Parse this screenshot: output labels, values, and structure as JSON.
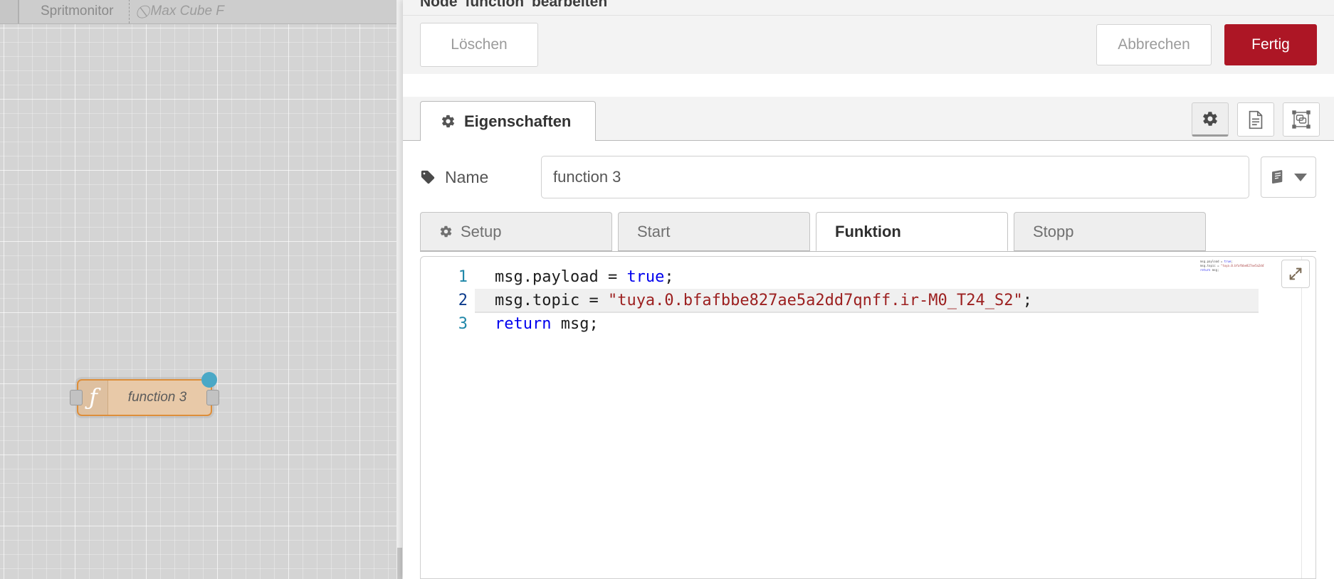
{
  "canvas": {
    "tabs": [
      {
        "label": "Spritmonitor",
        "icon": "",
        "disabled": false
      },
      {
        "label": "Max Cube F",
        "icon": "no-entry-icon",
        "disabled": true
      }
    ],
    "node": {
      "label": "function 3",
      "icon": "function-f-icon",
      "border_color": "#dd8e3a",
      "fill_color": "#e8c9a8",
      "status_dot_color": "#4aa8c6"
    }
  },
  "dialog": {
    "title": "Node 'function' bearbeiten",
    "buttons": {
      "delete": "Löschen",
      "cancel": "Abbrechen",
      "done": "Fertig",
      "done_color": "#ad1625"
    },
    "tabs": [
      {
        "label": "Eigenschaften",
        "icon": "gear-icon",
        "active": true
      }
    ],
    "icon_buttons": [
      {
        "name": "gear-icon",
        "active": true
      },
      {
        "name": "description-icon",
        "active": false
      },
      {
        "name": "appearance-icon",
        "active": false
      }
    ],
    "name_row": {
      "label": "Name",
      "icon": "tag-icon",
      "value": "function 3",
      "placeholder": "Name",
      "library_button_icon": "book-icon"
    },
    "function_tabs": [
      {
        "label": "Setup",
        "icon": "gear-icon",
        "active": false
      },
      {
        "label": "Start",
        "icon": "",
        "active": false
      },
      {
        "label": "Funktion",
        "icon": "",
        "active": true
      },
      {
        "label": "Stopp",
        "icon": "",
        "active": false
      }
    ],
    "editor": {
      "expand_icon": "expand-arrows-icon",
      "lines": [
        {
          "number": "1",
          "active": false,
          "segments": [
            {
              "text": "msg.payload = ",
              "type": "plain"
            },
            {
              "text": "true",
              "type": "keyword"
            },
            {
              "text": ";",
              "type": "plain"
            }
          ]
        },
        {
          "number": "2",
          "active": true,
          "segments": [
            {
              "text": "msg.topic = ",
              "type": "plain"
            },
            {
              "text": "\"tuya.0.bfafbbe827ae5a2dd7qnff.ir-M0_T24_S2\"",
              "type": "string"
            },
            {
              "text": ";",
              "type": "plain"
            }
          ]
        },
        {
          "number": "3",
          "active": false,
          "segments": [
            {
              "text": "return",
              "type": "keyword"
            },
            {
              "text": " msg;",
              "type": "plain"
            }
          ]
        }
      ]
    }
  }
}
